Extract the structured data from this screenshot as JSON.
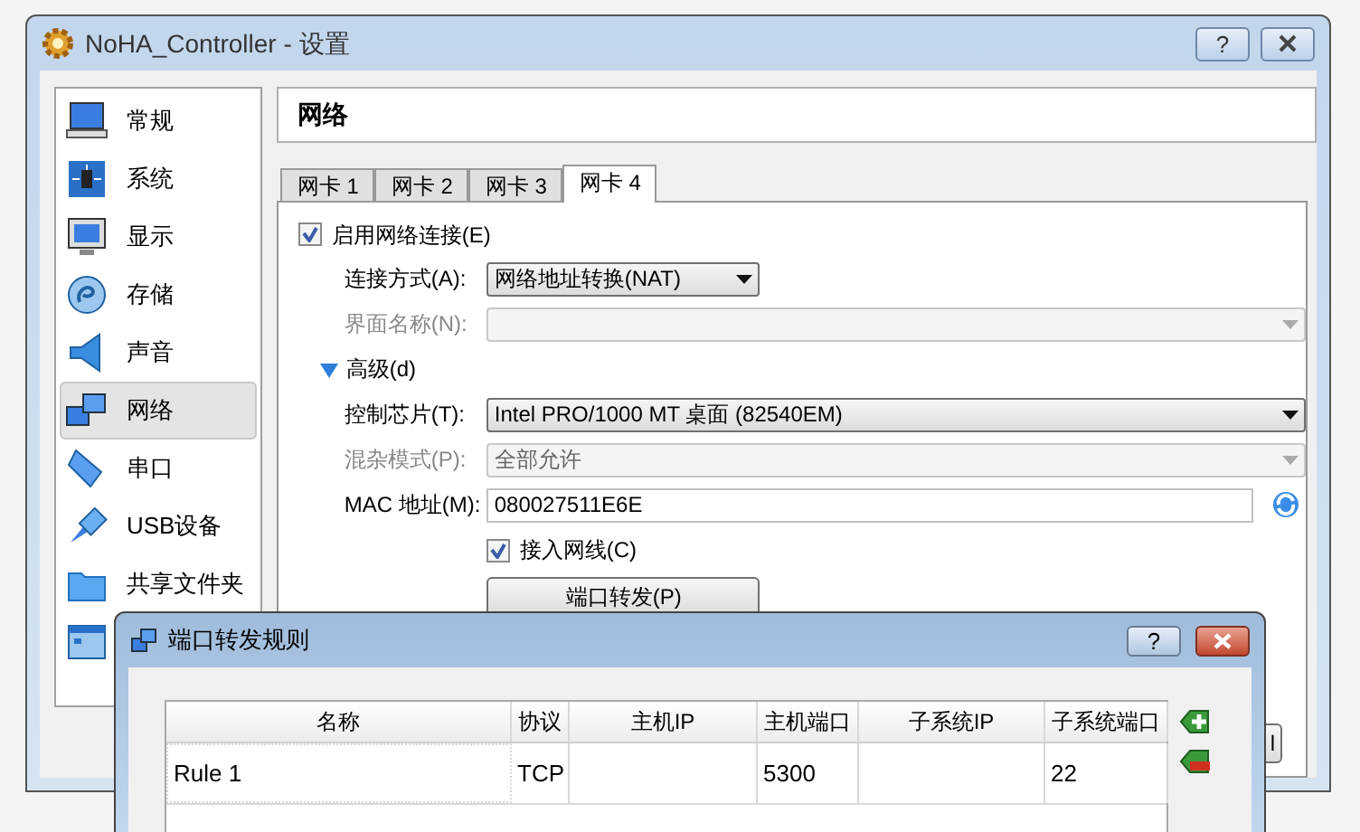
{
  "window": {
    "title": "NoHA_Controller - 设置",
    "help": "?"
  },
  "sidebar": {
    "items": [
      {
        "label": "常规",
        "selected": false
      },
      {
        "label": "系统",
        "selected": false
      },
      {
        "label": "显示",
        "selected": false
      },
      {
        "label": "存储",
        "selected": false
      },
      {
        "label": "声音",
        "selected": false
      },
      {
        "label": "网络",
        "selected": true
      },
      {
        "label": "串口",
        "selected": false
      },
      {
        "label": "USB设备",
        "selected": false
      },
      {
        "label": "共享文件夹",
        "selected": false
      },
      {
        "selected": false
      }
    ]
  },
  "header": "网络",
  "tabs": [
    {
      "label": "网卡 1",
      "selected": false
    },
    {
      "label": "网卡 2",
      "selected": false
    },
    {
      "label": "网卡 3",
      "selected": false
    },
    {
      "label": "网卡 4",
      "selected": true
    }
  ],
  "enable": {
    "label": "启用网络连接(E)",
    "checked": true
  },
  "rows": [
    {
      "kind": "select",
      "label": "连接方式(A):",
      "value": "网络地址转换(NAT)",
      "disabled": false
    },
    {
      "kind": "select",
      "label": "界面名称(N):",
      "disabled": true
    },
    {
      "kind": "toggle",
      "label": "高级(d)",
      "expanded": true
    },
    {
      "kind": "select",
      "label": "控制芯片(T):",
      "value": "Intel PRO/1000 MT 桌面 (82540EM)",
      "disabled": false
    },
    {
      "kind": "select",
      "label": "混杂模式(P):",
      "value": "全部允许",
      "disabled": true
    },
    {
      "kind": "text",
      "label": "MAC 地址(M):",
      "value": "080027511E6E"
    },
    {
      "kind": "checkbox",
      "label": "接入网线(C)",
      "checked": true
    },
    {
      "kind": "button",
      "label": "端口转发(P)"
    }
  ],
  "partial_button": "l",
  "dialog": {
    "title": "端口转发规则",
    "help": "?",
    "columns": [
      "名称",
      "协议",
      "主机IP",
      "主机端口",
      "子系统IP",
      "子系统端口"
    ],
    "rows": [
      [
        "Rule 1",
        "TCP",
        "",
        "5300",
        "",
        "22"
      ]
    ]
  }
}
